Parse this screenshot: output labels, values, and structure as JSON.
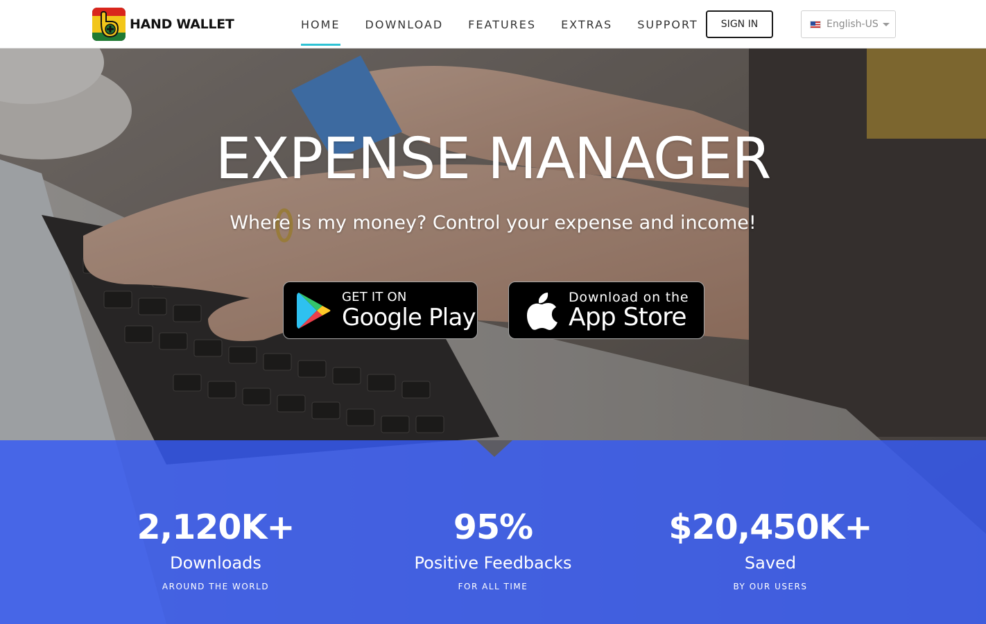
{
  "header": {
    "logo_text": "HAND WALLET",
    "nav": [
      {
        "label": "HOME",
        "active": true
      },
      {
        "label": "DOWNLOAD",
        "active": false
      },
      {
        "label": "FEATURES",
        "active": false
      },
      {
        "label": "EXTRAS",
        "active": false
      },
      {
        "label": "SUPPORT",
        "active": false
      }
    ],
    "signin_label": "SIGN IN",
    "language": {
      "selected": "English-US",
      "flag_icon": "us-flag-icon"
    }
  },
  "hero": {
    "title": "EXPENSE MANAGER",
    "subtitle": "Where is my money? Control your expense and income!",
    "google_play": {
      "small": "GET IT ON",
      "big": "Google Play",
      "icon": "google-play-icon"
    },
    "app_store": {
      "small": "Download on the",
      "big": "App Store",
      "icon": "apple-icon"
    }
  },
  "stats": [
    {
      "value": "2,120K+",
      "label": "Downloads",
      "caption": "AROUND THE WORLD"
    },
    {
      "value": "95%",
      "label": "Positive Feedbacks",
      "caption": "FOR ALL TIME"
    },
    {
      "value": "$20,450K+",
      "label": "Saved",
      "caption": "BY OUR USERS"
    }
  ],
  "colors": {
    "accent_underline": "#2ec2d4",
    "stats_band": "#3456e8",
    "store_button_bg": "#000000"
  }
}
